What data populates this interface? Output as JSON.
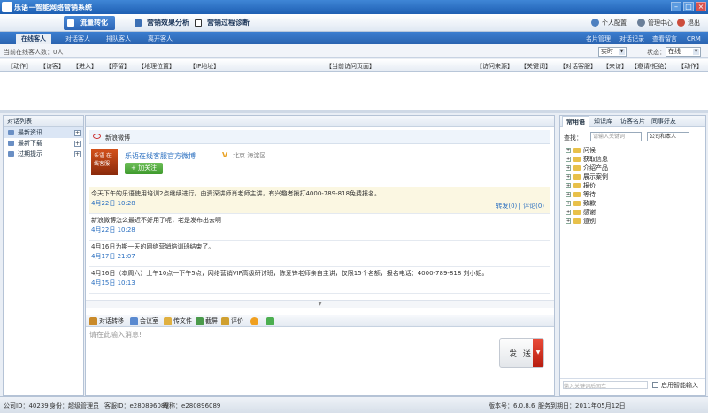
{
  "window": {
    "title": "乐语－智能网络营销系统"
  },
  "topnav": {
    "tabs": [
      {
        "label": "流量转化"
      },
      {
        "label": "营销效果分析"
      },
      {
        "label": "营销过程诊断"
      }
    ],
    "tools": [
      {
        "label": "个人配置"
      },
      {
        "label": "管理中心"
      },
      {
        "label": "退出"
      }
    ]
  },
  "subtabs": {
    "tabs": [
      {
        "label": "在线客人"
      },
      {
        "label": "对话客人"
      },
      {
        "label": "排队客人"
      },
      {
        "label": "离开客人"
      }
    ],
    "links": [
      {
        "label": "名片管理"
      },
      {
        "label": "对话记录"
      },
      {
        "label": "查看留言"
      },
      {
        "label": "CRM"
      }
    ]
  },
  "countbar": {
    "label": "当前在线客人数：0人",
    "mode": "实时",
    "status_label": "状态：",
    "status_value": "在线"
  },
  "columns": [
    "【动作】",
    "【访客】",
    "【进入】",
    "【停留】",
    "【地理位置】",
    "【IP地址】",
    "【当前访问页面】",
    "【访问来源】",
    "【关键词】",
    "【对话客服】",
    "【来访】",
    "【邀请/拒绝】",
    "【动作】"
  ],
  "leftpanel": {
    "title": "对话列表",
    "items": [
      {
        "label": "最新资讯"
      },
      {
        "label": "最新下载"
      },
      {
        "label": "过期提示"
      }
    ]
  },
  "weibo": {
    "header": "新浪微博",
    "avatar_text": "乐语 在线客服",
    "name": "乐语在线客服官方微博",
    "verified": "V",
    "location": "北京 海淀区",
    "follow": "+ 加关注",
    "posts": [
      {
        "text": "今天下午的乐语使用培训2点继续进行。由资深讲师肖老师主讲，有兴趣者拨打4000-789-818免费报名。",
        "date": "4月22日 10:28",
        "meta": "转发(0) | 评论(0)"
      },
      {
        "text": "新浪微博怎么最近不好用了呢，老是发布出去啊",
        "date": "4月22日 10:28",
        "meta": ""
      },
      {
        "text": "4月16日为期一天的网络营销培训班结束了。",
        "date": "4月17日 21:07",
        "meta": ""
      },
      {
        "text": "4月16日（本周六）上午10点一下午5点，网络营销VIP高级研讨班，陈爱锋老师亲自主讲，仅限15个名额，报名电话：4000-789-818 刘小姐。",
        "date": "4月15日 10:13",
        "meta": ""
      }
    ]
  },
  "chat": {
    "tools": [
      {
        "label": "对话转移"
      },
      {
        "label": "会议室"
      },
      {
        "label": "传文件"
      },
      {
        "label": "截屏"
      },
      {
        "label": "评价"
      }
    ],
    "placeholder": "请在此输入消息!",
    "send": "发 送"
  },
  "rightpanel": {
    "tabs": [
      {
        "label": "常用语"
      },
      {
        "label": "知识库"
      },
      {
        "label": "访客名片"
      },
      {
        "label": "同事好友"
      }
    ],
    "find_label": "查找：",
    "find_placeholder": "请输入关键词",
    "scope": "公司和本人",
    "tree": [
      "问候",
      "获取信息",
      "介绍产品",
      "展示案例",
      "报价",
      "等待",
      "致歉",
      "感谢",
      "道别"
    ],
    "bottom_placeholder": "输入关键词后回车",
    "smart_input": "启用智能输入"
  },
  "statusbar": {
    "company": "公司ID：40239",
    "role": "身份：超级管理员",
    "account": "客服ID：e280896089",
    "nickname": "昵称：e280896089",
    "version": "版本号：6.0.8.6",
    "expire": "服务到期日：2011年05月12日"
  }
}
